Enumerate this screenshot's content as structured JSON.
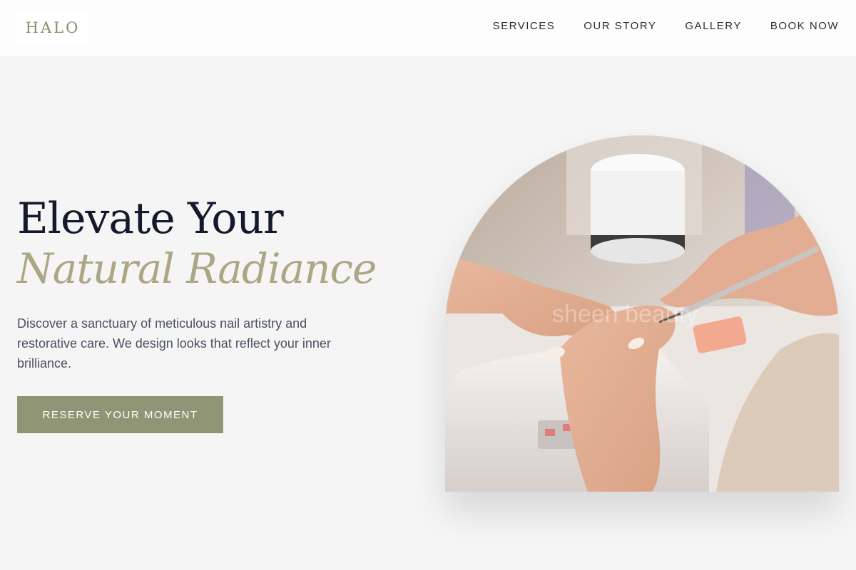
{
  "brand": {
    "logo_text": "HALO"
  },
  "nav": {
    "items": [
      {
        "label": "SERVICES"
      },
      {
        "label": "OUR STORY"
      },
      {
        "label": "GALLERY"
      },
      {
        "label": "BOOK NOW"
      }
    ]
  },
  "hero": {
    "title_line1": "Elevate Your",
    "title_line2": "Natural Radiance",
    "description": "Discover a sanctuary of meticulous nail artistry and restorative care. We design looks that reflect your inner brilliance.",
    "cta_label": "RESERVE YOUR MOMENT",
    "image_watermark": "sheen beauty"
  },
  "colors": {
    "background": "#f5f5f5",
    "accent": "#909575",
    "title_dark": "#141a2b",
    "title_accent": "#aba785",
    "logo": "#8e8c6e"
  },
  "icons": []
}
